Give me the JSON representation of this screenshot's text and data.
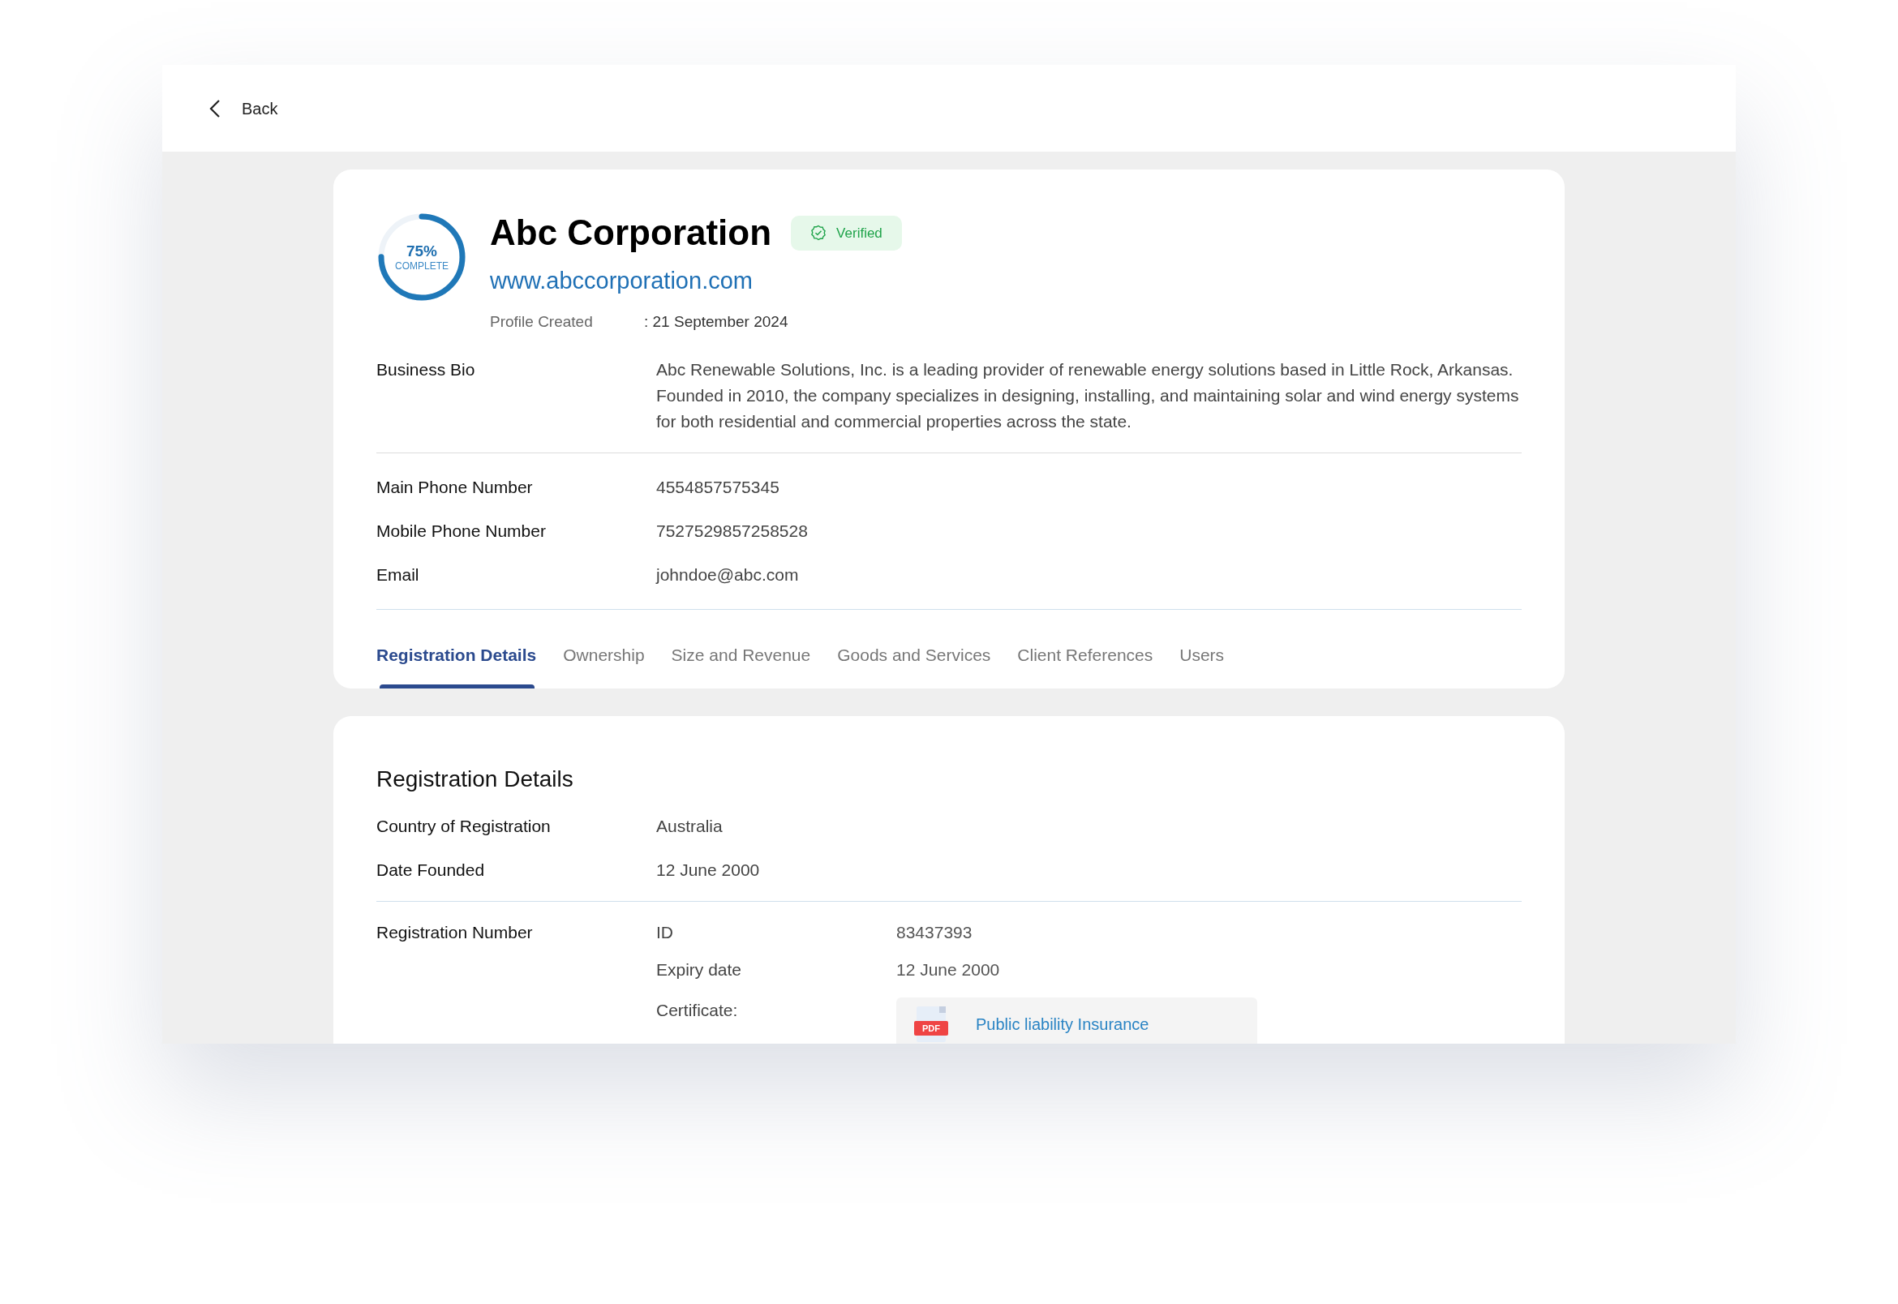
{
  "header": {
    "back_label": "Back"
  },
  "profile": {
    "completion": {
      "level": 0.75,
      "percent": "75%",
      "label": "COMPLETE"
    },
    "name": "Abc Corporation",
    "badge": {
      "label": "Verified",
      "verified": true
    },
    "website": "www.abccorporation.com",
    "created_label": "Profile Created",
    "created_value": ": 21 September 2024"
  },
  "bio": {
    "label": "Business Bio",
    "text": "Abc Renewable Solutions, Inc. is a leading provider of renewable energy solutions based in Little Rock, Arkansas. Founded in 2010, the company specializes in designing, installing, and maintaining solar and wind energy systems for both residential and commercial properties across the state."
  },
  "contacts": [
    {
      "label": "Main Phone Number",
      "value": "4554857575345"
    },
    {
      "label": "Mobile Phone Number",
      "value": "7527529857258528"
    },
    {
      "label": "Email",
      "value": "johndoe@abc.com"
    }
  ],
  "tabs": [
    {
      "label": "Registration Details",
      "selected": true
    },
    {
      "label": "Ownership",
      "selected": false
    },
    {
      "label": "Size and Revenue",
      "selected": false
    },
    {
      "label": "Goods and Services",
      "selected": false
    },
    {
      "label": "Client References",
      "selected": false
    },
    {
      "label": "Users",
      "selected": false
    }
  ],
  "registration": {
    "title": "Registration Details",
    "fields": [
      {
        "label": "Country of Registration",
        "value": "Australia"
      },
      {
        "label": "Date Founded",
        "value": "12 June 2000"
      }
    ],
    "number_label": "Registration Number",
    "id_label": "ID",
    "id_value": "83437393",
    "expiry_label": "Expiry date",
    "expiry_value": "12 June 2000",
    "certificate_label": "Certificate:",
    "certificate": {
      "file_type": "PDF",
      "name": "Public liability Insurance"
    }
  }
}
